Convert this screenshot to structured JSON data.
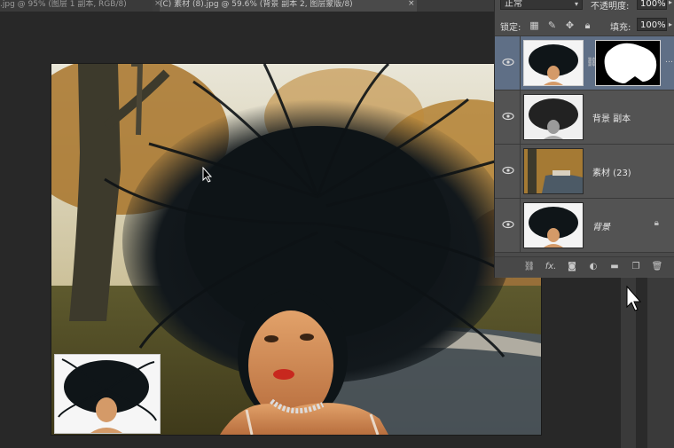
{
  "tabs": {
    "tab1_label": ".jpg @ 95% (图层 1 副本, RGB/8)",
    "tab2_label": "(C) 素材 (8).jpg @ 59.6% (背景 副本 2, 图层蒙版/8)",
    "close_glyph": "×"
  },
  "layers_panel": {
    "blend_mode": "正常",
    "opacity_label": "不透明度:",
    "opacity_value": "100%",
    "lock_label": "锁定:",
    "fill_label": "填充:",
    "fill_value": "100%",
    "layers": [
      {
        "name": "",
        "visible": true,
        "active": true,
        "has_mask": true
      },
      {
        "name": "背景 副本",
        "visible": true,
        "active": false
      },
      {
        "name": "素材 (23)",
        "visible": true,
        "active": false
      },
      {
        "name": "背景",
        "visible": true,
        "active": false,
        "locked": true
      }
    ],
    "footer_icons": [
      "link-icon",
      "fx-icon",
      "add-mask-icon",
      "adjustment-icon",
      "folder-icon",
      "new-layer-icon",
      "trash-icon"
    ],
    "fx_label": "fx."
  },
  "colors": {
    "panel_bg": "#4b4b4b",
    "active_layer": "#5f6f86",
    "canvas_bg": "#282828"
  }
}
